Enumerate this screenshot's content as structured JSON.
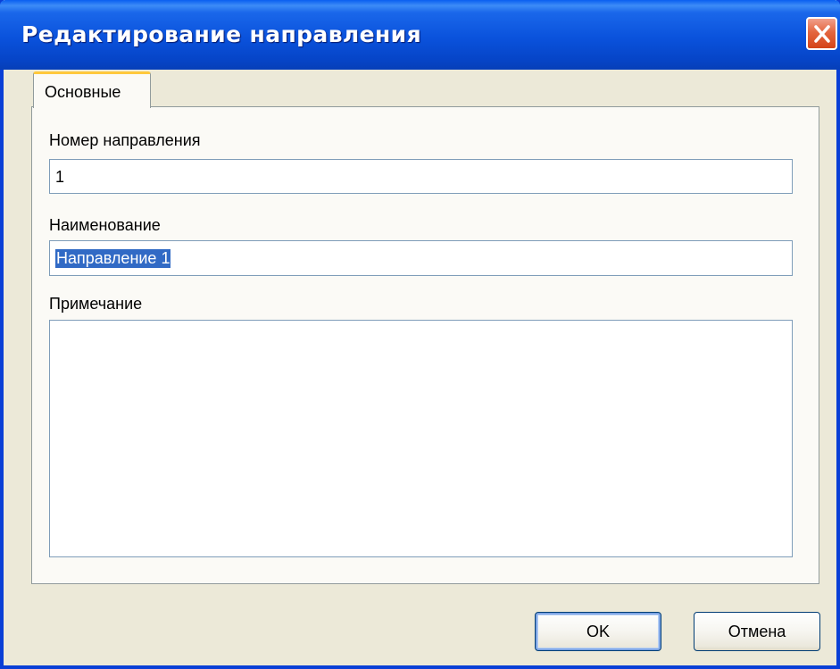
{
  "window": {
    "title": "Редактирование направления"
  },
  "icons": {
    "close": "close-icon"
  },
  "colors": {
    "titlebar": "#0a52dc",
    "close_button": "#e4663f",
    "tab_accent": "#ffc83c",
    "selection": "#316ac5",
    "dialog_bg": "#ece9d8"
  },
  "tabs": [
    {
      "label": "Основные",
      "active": true
    }
  ],
  "form": {
    "number": {
      "label": "Номер направления",
      "value": "1"
    },
    "name": {
      "label": "Наименование",
      "value": "Направление 1",
      "selected": true
    },
    "note": {
      "label": "Примечание",
      "value": ""
    }
  },
  "buttons": {
    "ok": "OK",
    "cancel": "Отмена"
  }
}
